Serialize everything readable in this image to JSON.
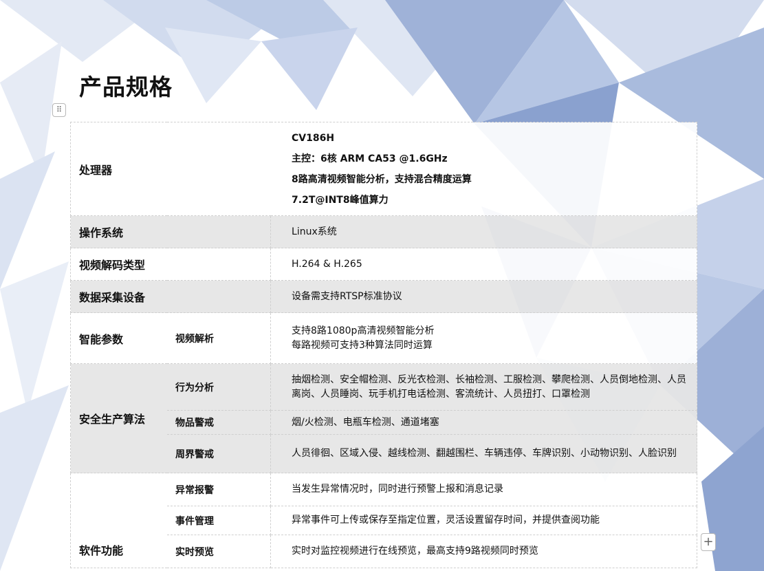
{
  "title": "产品规格",
  "rows": {
    "processor": {
      "label": "处理器",
      "lines": [
        "CV186H",
        "主控：6核 ARM CA53 @1.6GHz",
        "8路高清视频智能分析，支持混合精度运算",
        "7.2T@INT8峰值算力"
      ]
    },
    "os": {
      "label": "操作系统",
      "value": "Linux系统"
    },
    "decode": {
      "label": "视频解码类型",
      "value": "H.264 & H.265"
    },
    "capture": {
      "label": "数据采集设备",
      "value": "设备需支持RTSP标准协议"
    },
    "smart": {
      "label": "智能参数",
      "sub": "视频解析",
      "lines": [
        "支持8路1080p高清视频智能分析",
        "每路视频可支持3种算法同时运算"
      ]
    },
    "safety": {
      "label": "安全生产算法",
      "items": [
        {
          "sub": "行为分析",
          "value": "抽烟检测、安全帽检测、反光衣检测、长袖检测、工服检测、攀爬检测、人员倒地检测、人员离岗、人员睡岗、玩手机打电话检测、客流统计、人员扭打、口罩检测"
        },
        {
          "sub": "物品警戒",
          "value": "烟/火检测、电瓶车检测、通道堵塞"
        },
        {
          "sub": "周界警戒",
          "value": "人员徘徊、区域入侵、越线检测、翻越围栏、车辆违停、车牌识别、小动物识别、人脸识别"
        }
      ]
    },
    "software": {
      "label": "软件功能",
      "items": [
        {
          "sub": "异常报警",
          "value": "当发生异常情况时，同时进行预警上报和消息记录"
        },
        {
          "sub": "事件管理",
          "value": "异常事件可上传或保存至指定位置，灵活设置留存时间，并提供查阅功能"
        },
        {
          "sub": "实时预览",
          "value": "实时对监控视频进行在线预览，最高支持9路视频同时预览"
        }
      ]
    }
  },
  "controls": {
    "drag_handle_icon": "grip-dots-icon",
    "add_icon": "plus-icon"
  },
  "colors": {
    "background_shard": "#9fb2d8",
    "row_gray": "#e6e6e6"
  }
}
